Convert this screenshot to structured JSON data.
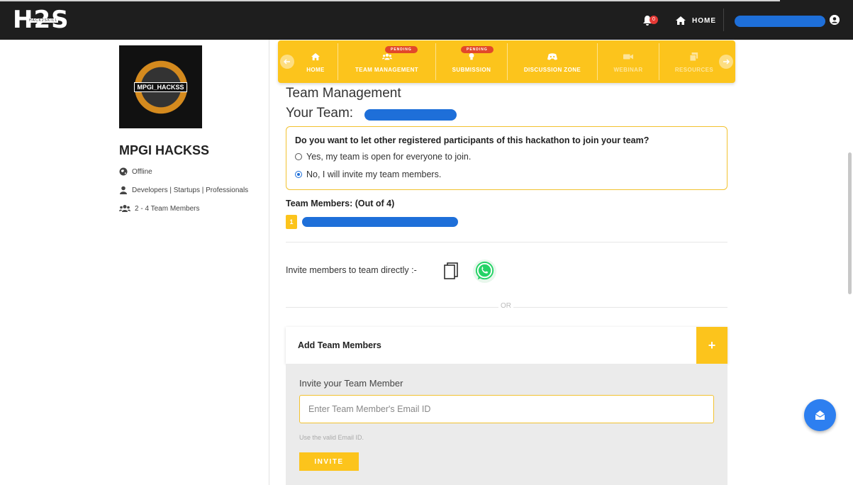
{
  "header": {
    "logo_text": "H2S",
    "logo_subtext": "HACK2SKILL",
    "notification_count": "0",
    "home_label": "HOME"
  },
  "organizer": {
    "logo_tag": "MPGI_HACKSS",
    "name": "MPGI HACKSS",
    "mode": "Offline",
    "audience": "Developers | Startups | Professionals",
    "team_size": "2 - 4 Team Members"
  },
  "tabs": [
    {
      "label": "HOME",
      "icon": "home-icon"
    },
    {
      "label": "TEAM MANAGEMENT",
      "icon": "users-icon",
      "badge": "PENDING"
    },
    {
      "label": "SUBMISSION",
      "icon": "lightbulb-icon",
      "badge": "PENDING"
    },
    {
      "label": "DISCUSSION ZONE",
      "icon": "discord-icon"
    },
    {
      "label": "WEBINAR",
      "icon": "video-icon"
    },
    {
      "label": "RESOURCES",
      "icon": "files-icon"
    }
  ],
  "main": {
    "title": "Team Management",
    "your_team_label": "Your Team:",
    "question": "Do you want to let other registered participants of this hackathon to join your team?",
    "option_open": "Yes, my team is open for everyone to join.",
    "option_invite": "No, I will invite my team members.",
    "selected_option": "invite",
    "members_title": "Team Members: (Out of 4)",
    "member_index": "1",
    "invite_direct_label": "Invite members to team directly :-",
    "or_label": "OR",
    "add_members_label": "Add Team Members",
    "add_symbol": "+",
    "invite_label": "Invite your Team Member",
    "email_placeholder": "Enter Team Member's Email ID",
    "email_hint": "Use the valid Email ID.",
    "invite_button": "INVITE"
  },
  "colors": {
    "accent": "#fcc41c",
    "topbar": "#1e1e1e",
    "pending": "#e2482a",
    "fab": "#2d7ff0"
  }
}
